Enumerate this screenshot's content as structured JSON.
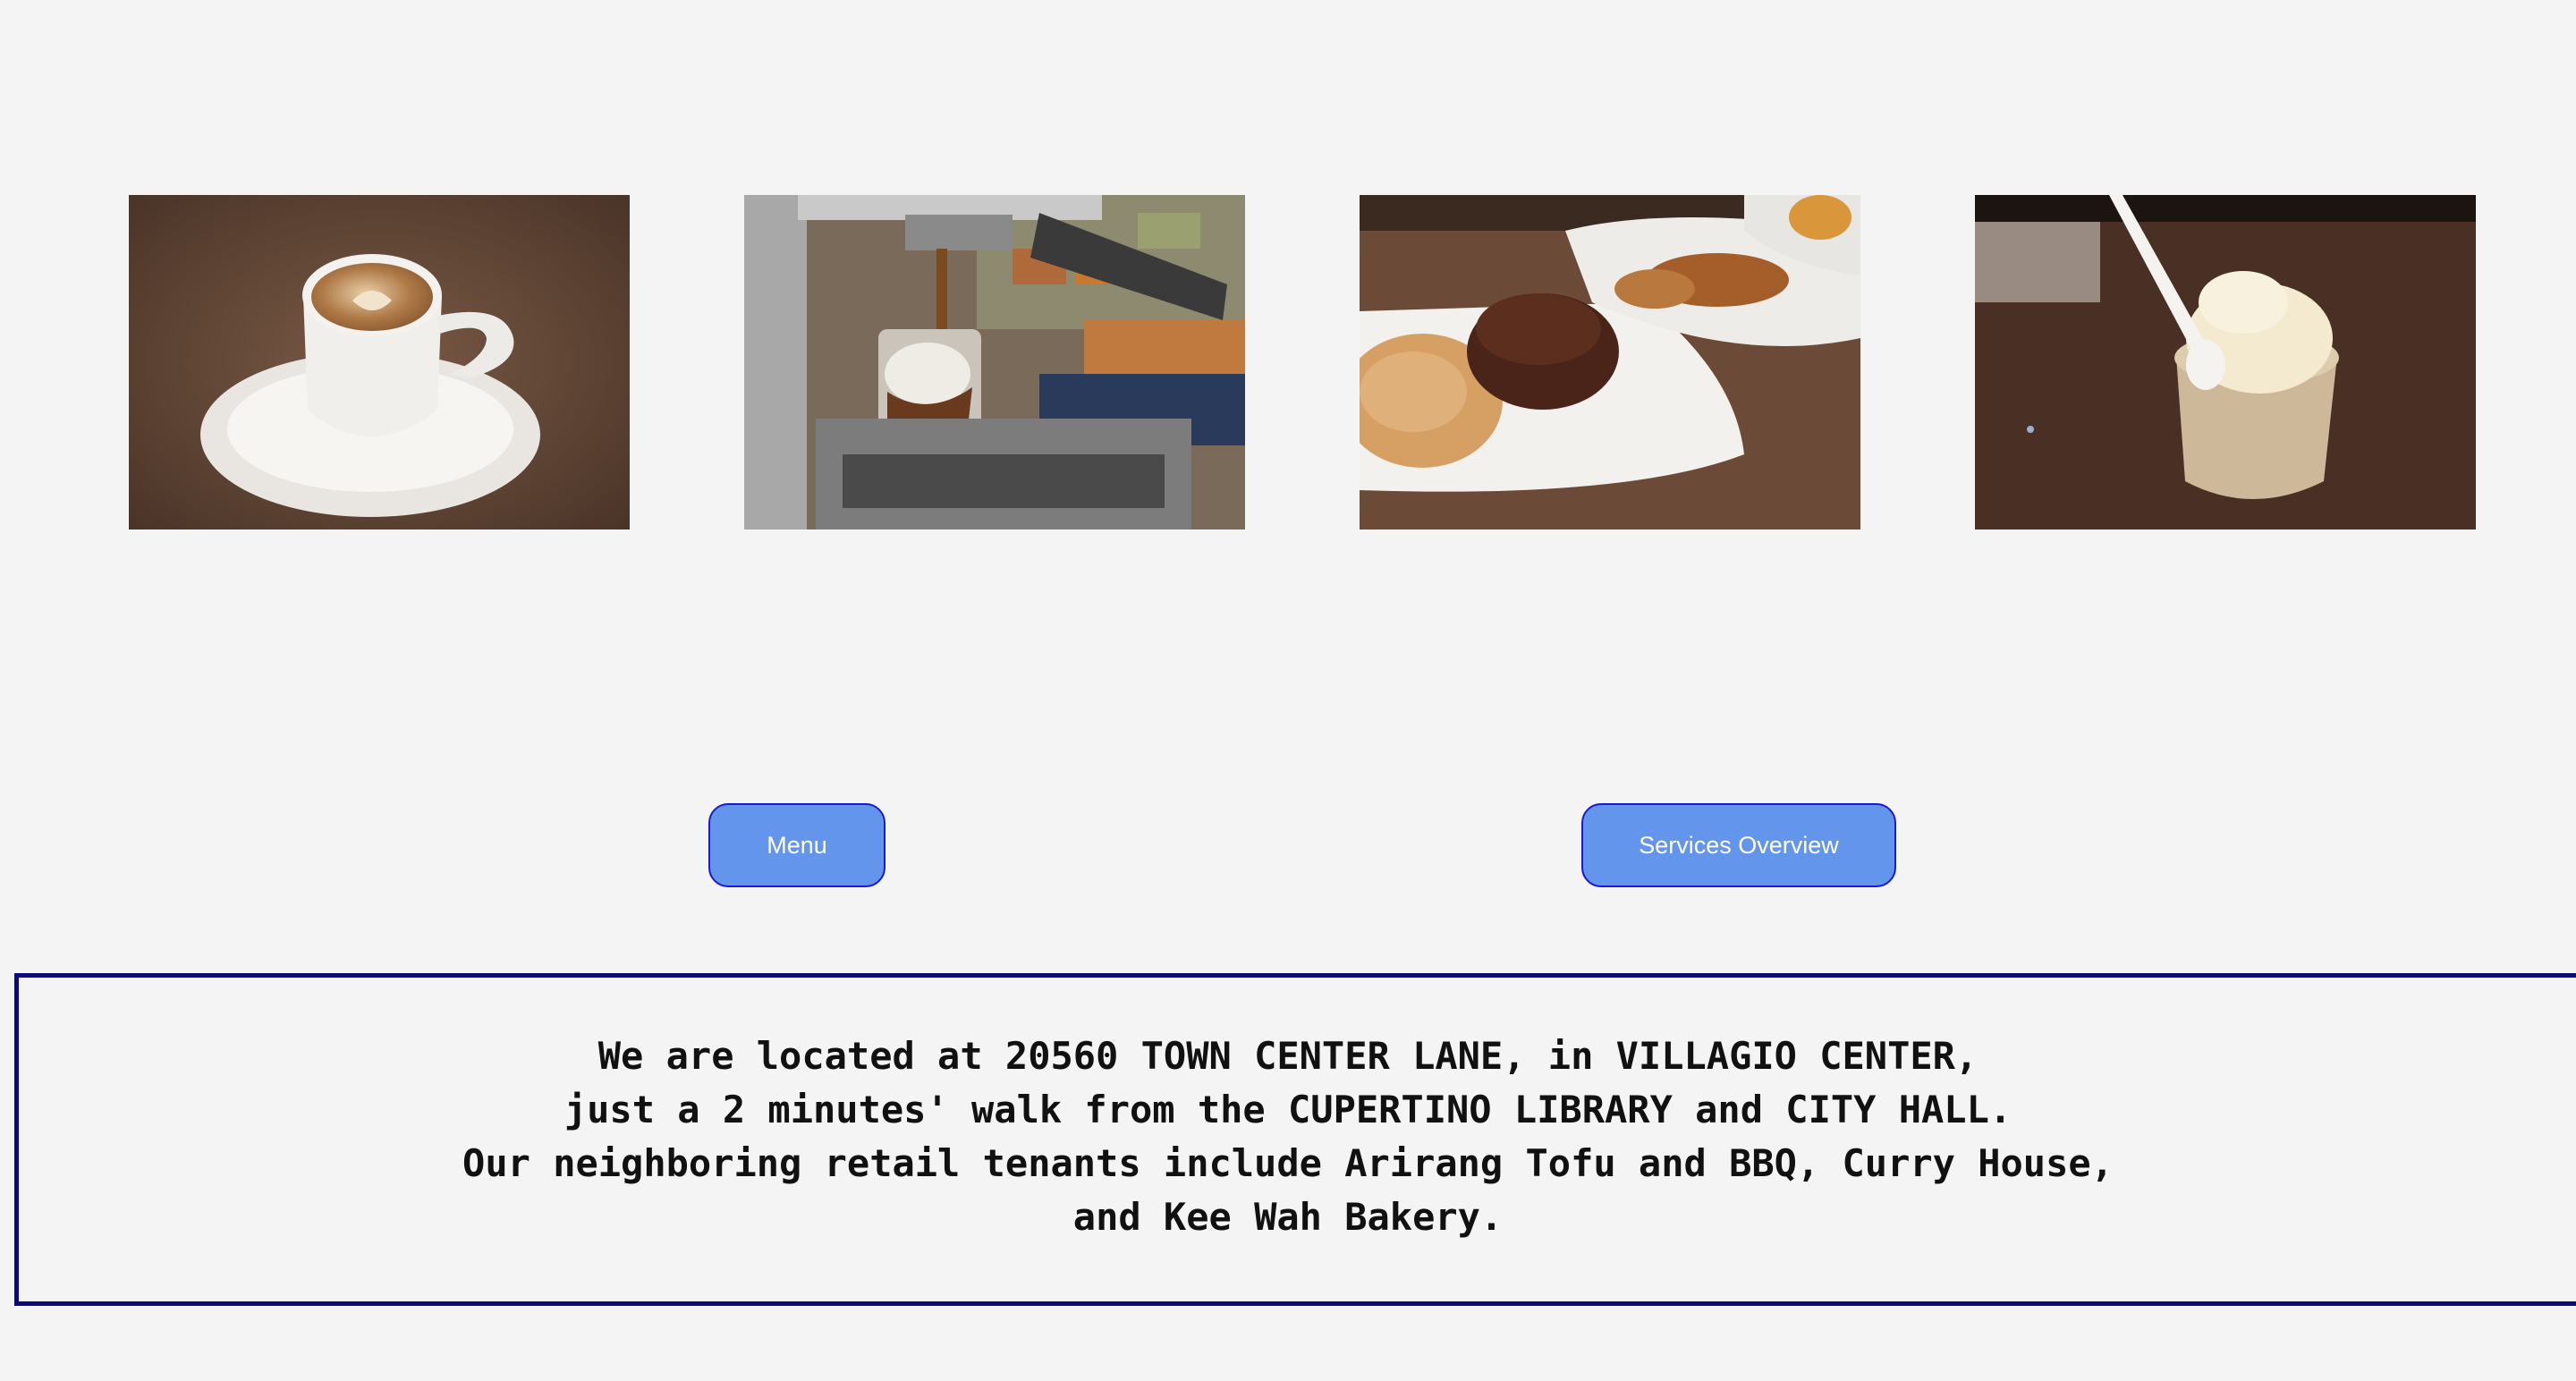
{
  "gallery": {
    "photos": [
      {
        "subject": "latte art cappuccino cup on saucer",
        "icon": "coffee-cup-photo"
      },
      {
        "subject": "espresso machine pouring affogato",
        "icon": "espresso-machine-photo"
      },
      {
        "subject": "pastries and muffin on white plates",
        "icon": "pastry-plate-photo"
      },
      {
        "subject": "ice cream scoop in paper cup with spoon",
        "icon": "ice-cream-photo"
      }
    ]
  },
  "buttons": {
    "menu_label": "Menu",
    "services_label": "Services Overview",
    "color": "#6495ed",
    "border_color": "#1a1ad0"
  },
  "location": {
    "line1": "We are located at 20560 TOWN CENTER LANE, in VILLAGIO CENTER,",
    "line2": "just a 2 minutes' walk from the CUPERTINO LIBRARY and CITY HALL.",
    "line3": "Our neighboring retail tenants include Arirang Tofu and BBQ, Curry House,",
    "line4": "and Kee Wah Bakery.",
    "border_color": "#0a0a78"
  }
}
